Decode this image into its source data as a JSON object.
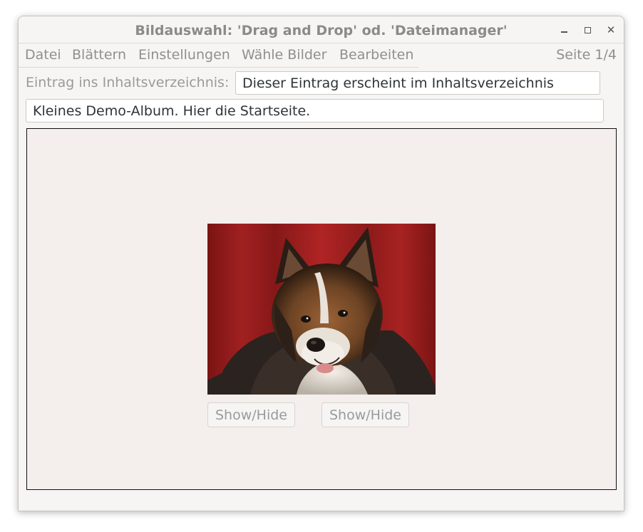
{
  "window": {
    "title": "Bildauswahl: 'Drag and Drop' od. 'Dateimanager'"
  },
  "menu": {
    "items": [
      "Datei",
      "Blättern",
      "Einstellungen",
      "Wähle Bilder",
      "Bearbeiten"
    ],
    "page_indicator": "Seite 1/4"
  },
  "toc": {
    "label": "Eintrag ins Inhaltsverzeichnis:",
    "value": "Dieser Eintrag erscheint im Inhaltsverzeichnis"
  },
  "page_text": {
    "value": "Kleines Demo-Album. Hier die Startseite."
  },
  "image": {
    "subject": "dog-photo"
  },
  "buttons": {
    "show_hide_1": "Show/Hide",
    "show_hide_2": "Show/Hide"
  },
  "icons": {
    "minimize": "minimize-icon",
    "maximize": "maximize-icon",
    "close": "close-icon"
  }
}
